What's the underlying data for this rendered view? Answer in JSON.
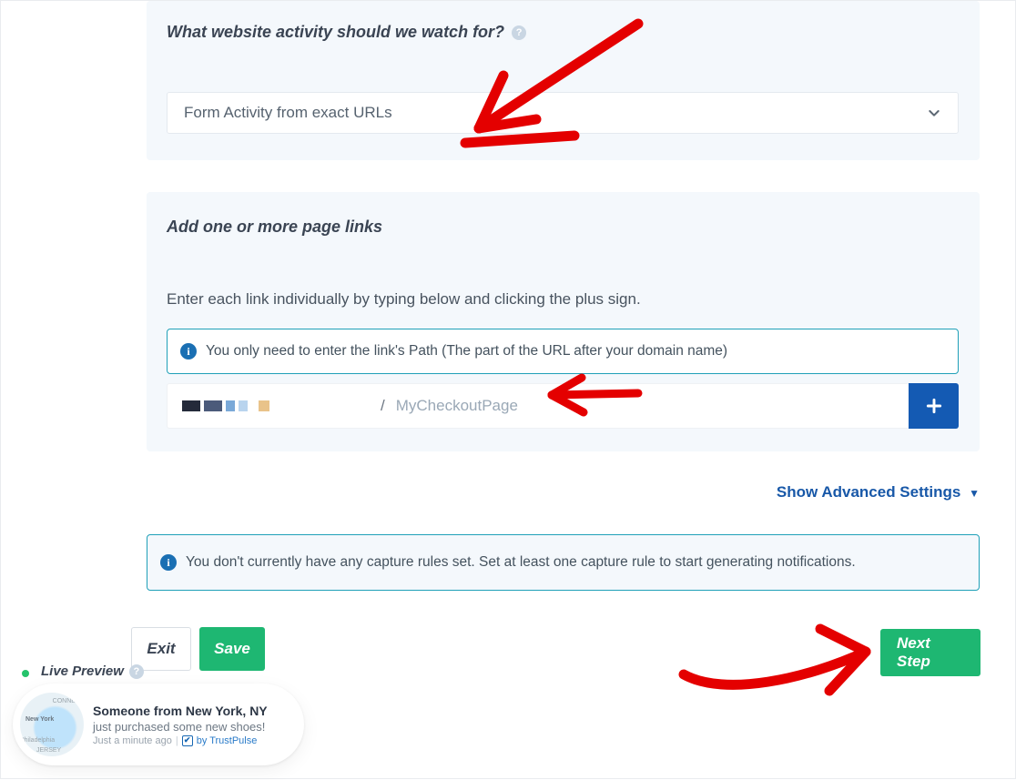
{
  "panel1": {
    "title": "What website activity should we watch for?",
    "select_value": "Form Activity from exact URLs"
  },
  "panel2": {
    "title": "Add one or more page links",
    "instruction": "Enter each link individually by typing below and clicking the plus sign.",
    "info": "You only need to enter the link's Path (The part of the URL after your domain name)",
    "path_separator": "/",
    "path_placeholder": "MyCheckoutPage"
  },
  "advanced_link": "Show Advanced Settings",
  "warning": "You don't currently have any capture rules set. Set at least one capture rule to start generating notifications.",
  "buttons": {
    "exit": "Exit",
    "save": "Save",
    "next": "Next Step"
  },
  "live_preview": {
    "label": "Live Preview",
    "toast_title": "Someone from New York, NY",
    "toast_sub": "just purchased some new shoes!",
    "toast_time": "Just a minute ago",
    "toast_by_prefix": "by ",
    "toast_brand": "TrustPulse",
    "map_labels": {
      "conn": "CONNEC",
      "ny": "New York",
      "phil": "Philadelphia",
      "jersey": "JERSEY"
    }
  }
}
